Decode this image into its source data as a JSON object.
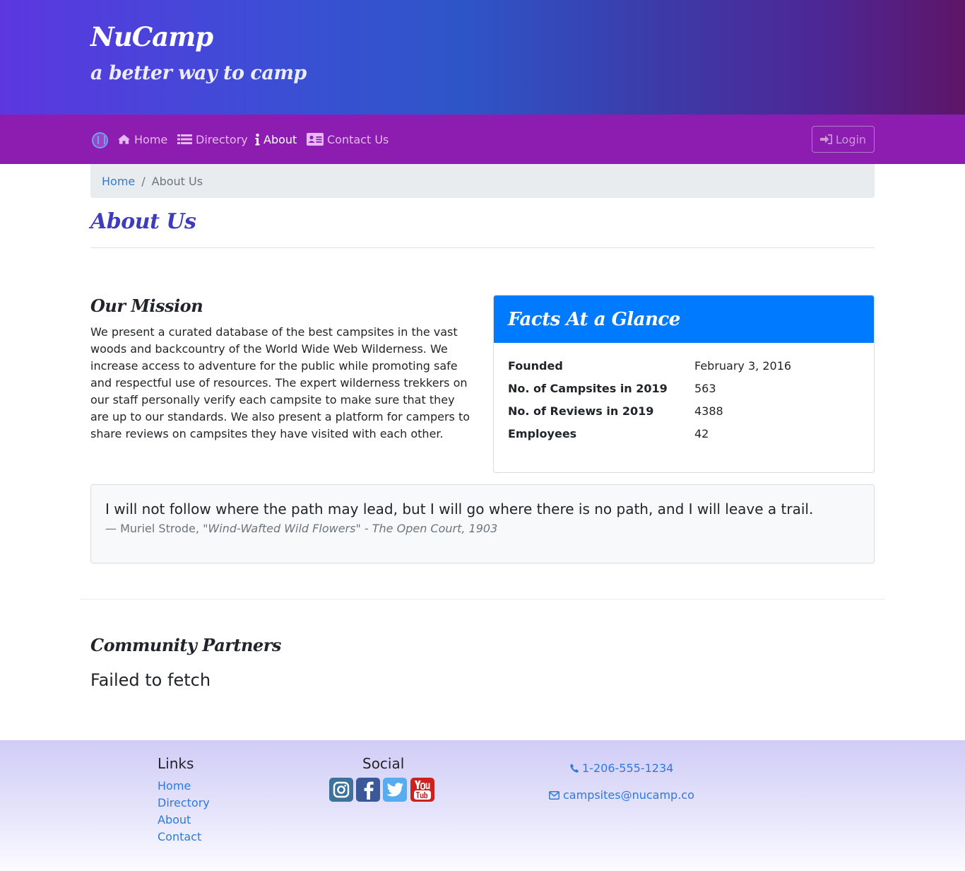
{
  "header": {
    "brand": "NuCamp",
    "tagline": "a better way to camp"
  },
  "nav": {
    "logo_icon": "nucamp-logo-icon",
    "items": [
      {
        "label": "Home",
        "icon": "home-icon"
      },
      {
        "label": "Directory",
        "icon": "list-icon"
      },
      {
        "label": "About",
        "icon": "info-icon",
        "active": true
      },
      {
        "label": "Contact Us",
        "icon": "address-card-icon"
      }
    ],
    "login_label": "Login",
    "login_icon": "sign-in-icon"
  },
  "breadcrumb": {
    "home": "Home",
    "separator": "/",
    "current": "About Us"
  },
  "page": {
    "title": "About Us"
  },
  "mission": {
    "heading": "Our Mission",
    "body": "We present a curated database of the best campsites in the vast woods and backcountry of the World Wide Web Wilderness. We increase access to adventure for the public while promoting safe and respectful use of resources. The expert wilderness trekkers on our staff personally verify each campsite to make sure that they are up to our standards. We also present a platform for campers to share reviews on campsites they have visited with each other."
  },
  "facts": {
    "title": "Facts At a Glance",
    "rows": [
      {
        "label": "Founded",
        "value": "February 3, 2016"
      },
      {
        "label": "No. of Campsites in 2019",
        "value": "563"
      },
      {
        "label": "No. of Reviews in 2019",
        "value": "4388"
      },
      {
        "label": "Employees",
        "value": "42"
      }
    ]
  },
  "quote": {
    "text": "I will not follow where the path may lead, but I will go where there is no path, and I will leave a trail.",
    "author": "— Muriel Strode,",
    "source": "\"Wind-Wafted Wild Flowers\" - The Open Court, 1903"
  },
  "partners": {
    "heading": "Community Partners",
    "status": "Failed to fetch"
  },
  "footer": {
    "links_heading": "Links",
    "links": [
      "Home",
      "Directory",
      "About",
      "Contact"
    ],
    "social_heading": "Social",
    "social": [
      {
        "icon": "instagram-icon",
        "color": "#3f729b"
      },
      {
        "icon": "facebook-icon",
        "color": "#3b5998"
      },
      {
        "icon": "twitter-icon",
        "color": "#55acee"
      },
      {
        "icon": "youtube-icon",
        "color": "#cd201f"
      }
    ],
    "phone": "1-206-555-1234",
    "email": "campsites@nucamp.co"
  },
  "colors": {
    "navbar": "#8d1cb0",
    "link": "#2b7ae0",
    "facts_header": "#007bff",
    "title": "#3e3bbf"
  }
}
